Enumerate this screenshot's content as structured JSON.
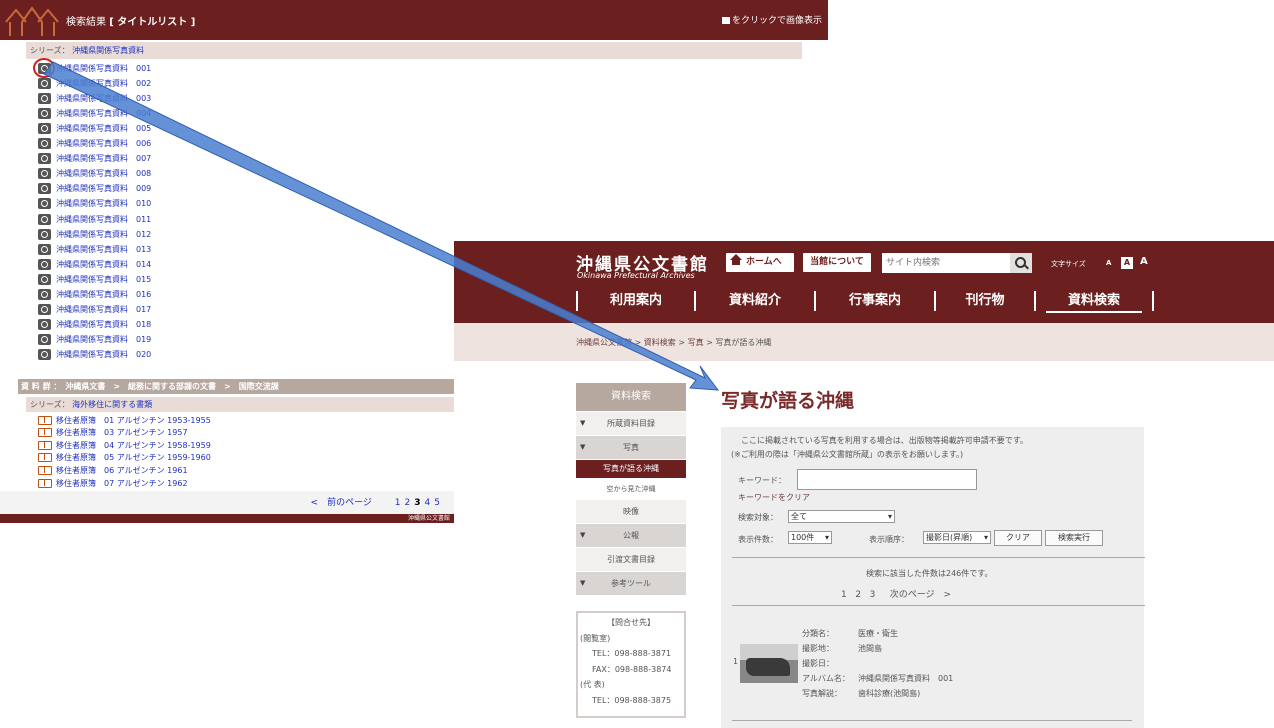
{
  "left": {
    "header_title_prefix": "検索結果",
    "header_title_bracket": "[ タイトルリスト ]",
    "click_hint": "をクリックで画像表示",
    "series1_label": "シリーズ：",
    "series1_value": "沖縄県関係写真資料",
    "photo_items": [
      "沖縄県関係写真資料　001",
      "沖縄県関係写真資料　002",
      "沖縄県関係写真資料　003",
      "沖縄県関係写真資料　004",
      "沖縄県関係写真資料　005",
      "沖縄県関係写真資料　006",
      "沖縄県関係写真資料　007",
      "沖縄県関係写真資料　008",
      "沖縄県関係写真資料　009",
      "沖縄県関係写真資料　010",
      "沖縄県関係写真資料　011",
      "沖縄県関係写真資料　012",
      "沖縄県関係写真資料　013",
      "沖縄県関係写真資料　014",
      "沖縄県関係写真資料　015",
      "沖縄県関係写真資料　016",
      "沖縄県関係写真資料　017",
      "沖縄県関係写真資料　018",
      "沖縄県関係写真資料　019",
      "沖縄県関係写真資料　020"
    ],
    "path_bar": "資 料 群 ：　沖縄県文書　>　総務に関する部課の文書　>　国際交流課",
    "series2_label": "シリーズ：",
    "series2_value": "海外移住に関する書類",
    "doc_items": [
      "移住者原簿　01 アルゼンチン 1953-1955",
      "移住者原簿　03 アルゼンチン 1957",
      "移住者原簿　04 アルゼンチン 1958-1959",
      "移住者原簿　05 アルゼンチン 1959-1960",
      "移住者原簿　06 アルゼンチン 1961",
      "移住者原簿　07 アルゼンチン 1962"
    ],
    "pager": {
      "prev": "<　前のページ",
      "pages": [
        "1",
        "2",
        "3",
        "4",
        "5"
      ],
      "current": "3"
    },
    "footer": "沖縄県公文書館"
  },
  "right": {
    "site_title": "沖縄県公文書館",
    "site_subtitle": "Okinawa Prefectural Archives",
    "home_button": "ホームへ",
    "about_button": "当館について",
    "search_placeholder": "サイト内検索",
    "font_size_label": "文字サイズ",
    "font_sizes": [
      "A",
      "A",
      "A"
    ],
    "global_nav": [
      "利用案内",
      "資料紹介",
      "行事案内",
      "刊行物",
      "資料検索"
    ],
    "breadcrumb": [
      "沖縄県公文書館",
      "資料検索",
      "写真",
      "写真が語る沖縄"
    ],
    "breadcrumb_sep": " > ",
    "side_nav": {
      "title": "資料検索",
      "items": [
        "所蔵資料目録",
        "写真",
        "写真が語る沖縄",
        "空から見た沖縄",
        "映像",
        "公報",
        "引渡文書目録",
        "参考ツール"
      ]
    },
    "contact": {
      "title": "【問合せ先】",
      "reading_room": "(閲覧室)",
      "tel1": "TEL：098-888-3871",
      "fax": "FAX：098-888-3874",
      "main": "(代 表)",
      "tel2": "TEL：098-888-3875"
    },
    "page_heading": "写真が語る沖縄",
    "notice1": "ここに掲載されている写真を利用する場合は、出版物等掲載許可申請不要です。",
    "notice2": "(※ご利用の際は「沖縄県公文書館所蔵」の表示をお願いします。)",
    "keyword_label": "キーワード：",
    "keyword_clear": "キーワードをクリア",
    "target_label": "検索対象：",
    "target_value": "全て",
    "count_label": "表示件数：",
    "count_value": "100件",
    "order_label": "表示順序：",
    "order_value": "撮影日(昇順)",
    "clear_button": "クリア",
    "search_button": "検索実行",
    "result_count": "検索に該当した件数は246件です。",
    "result_pages": [
      "1",
      "2",
      "3"
    ],
    "next_page": "次のページ　>",
    "result": {
      "index": "1",
      "category_label": "分類名：",
      "category_value": "医療・衛生",
      "place_label": "撮影地：",
      "place_value": "池間島",
      "date_label": "撮影日：",
      "date_value": "",
      "album_label": "アルバム名：",
      "album_value": "沖縄県関係写真資料　001",
      "desc_label": "写真解説：",
      "desc_value": "歯科診療(池間島)"
    }
  },
  "colors": {
    "header_maroon": "#6b1f1f",
    "link_blue": "#2030c0",
    "arrow_blue": "#4a7fd0",
    "highlight_red": "#d02020"
  }
}
